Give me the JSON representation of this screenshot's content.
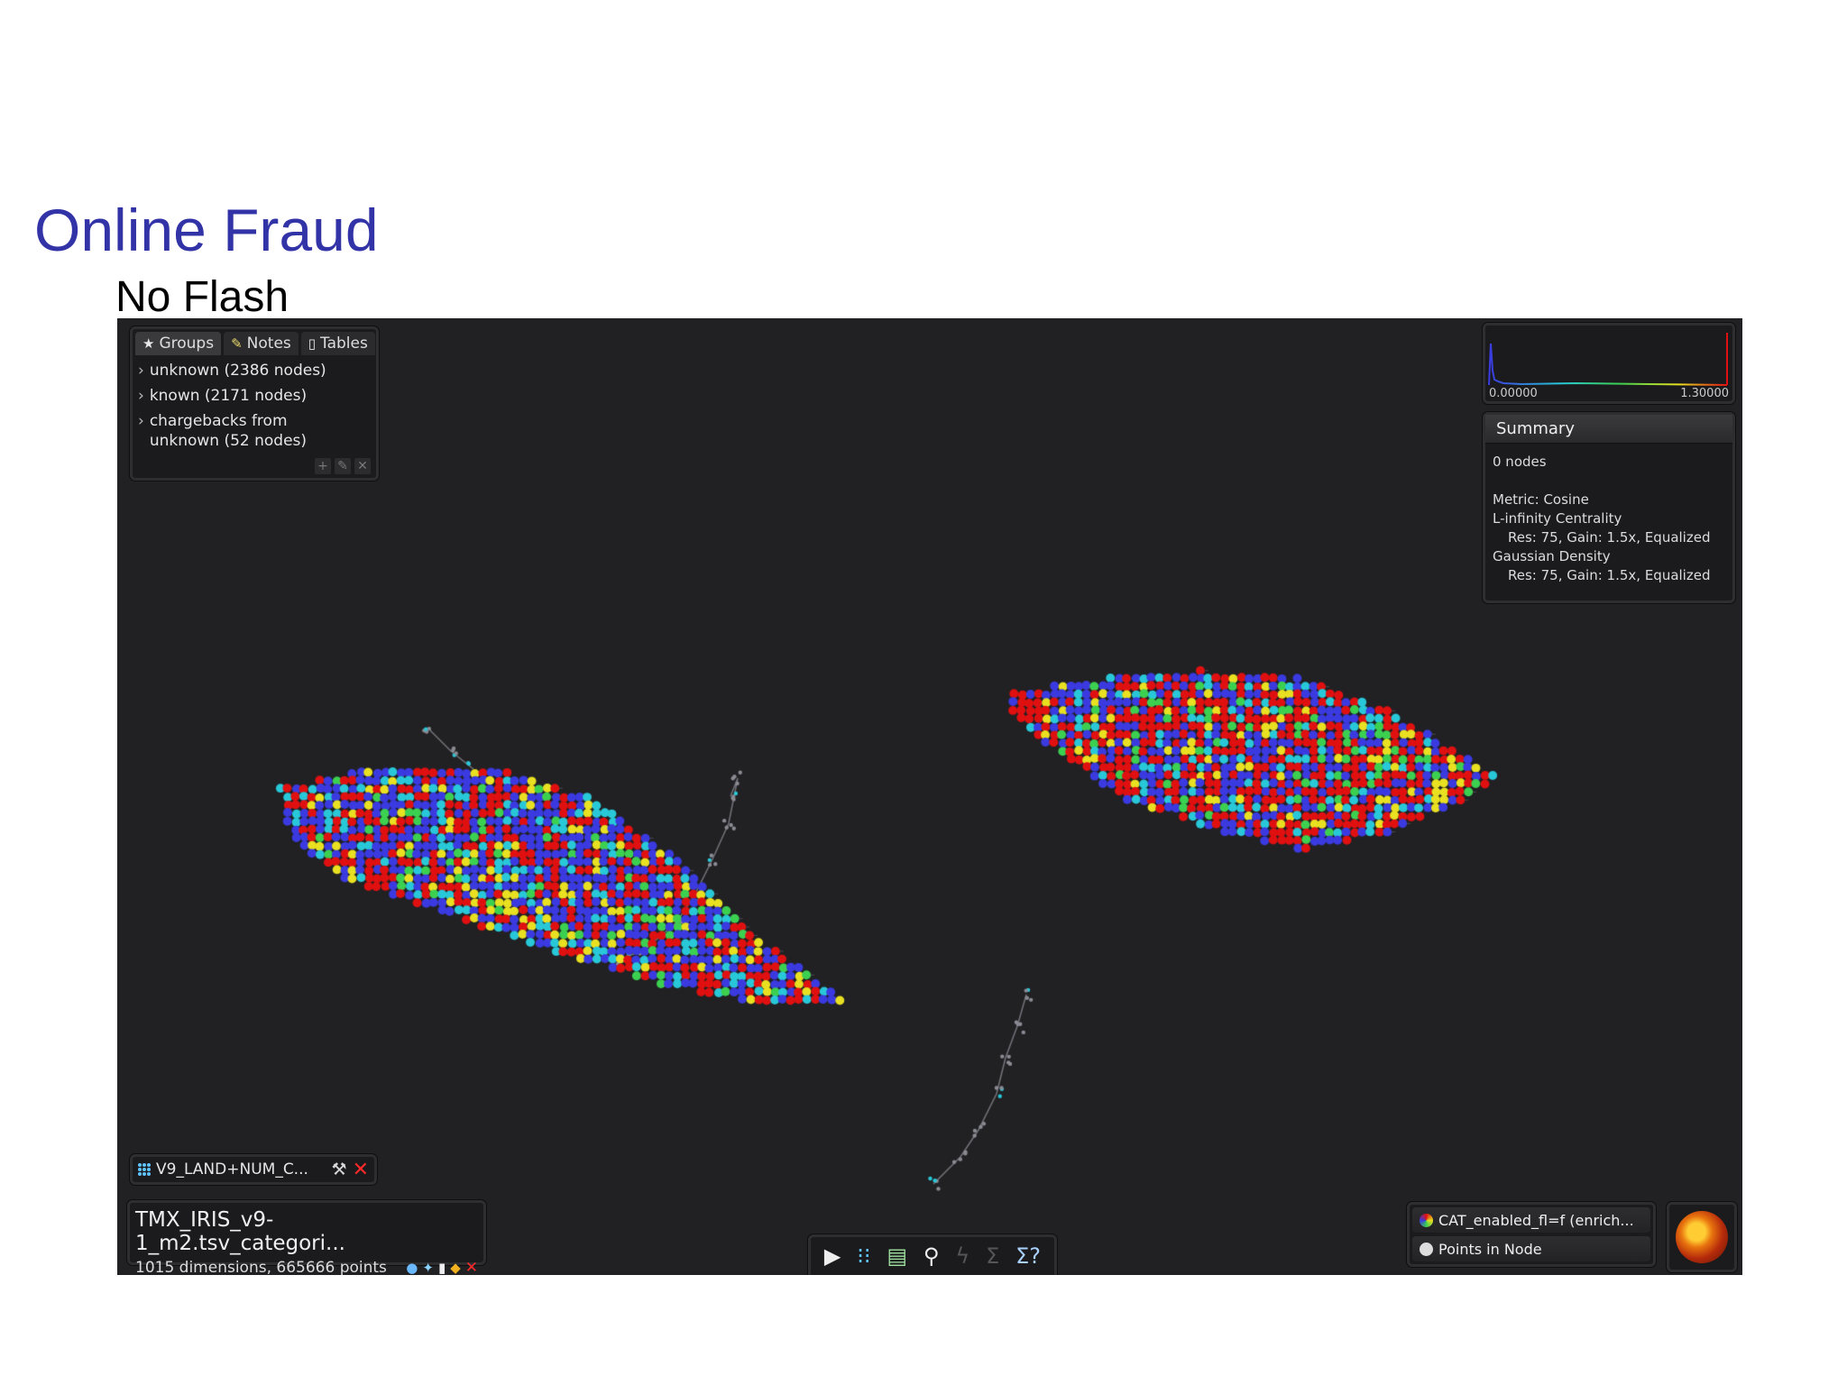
{
  "slide": {
    "title": "Online Fraud",
    "subtitle": "No Flash"
  },
  "groups_panel": {
    "tabs": [
      {
        "label": "Groups",
        "icon": "star-icon"
      },
      {
        "label": "Notes",
        "icon": "note-icon"
      },
      {
        "label": "Tables",
        "icon": "document-icon"
      }
    ],
    "items": [
      {
        "label": "unknown (2386 nodes)"
      },
      {
        "label": "known (2171 nodes)"
      },
      {
        "label": "chargebacks from unknown (52 nodes)"
      }
    ]
  },
  "histogram": {
    "min_label": "0.00000",
    "max_label": "1.30000"
  },
  "summary": {
    "title": "Summary",
    "nodes": "0 nodes",
    "metric": "Metric: Cosine",
    "lens1": "L-infinity Centrality",
    "lens1_params": "Res: 75, Gain: 1.5x, Equalized",
    "lens2": "Gaussian Density",
    "lens2_params": "Res: 75, Gain: 1.5x, Equalized"
  },
  "lens_panel": {
    "label": "V9_LAND+NUM_C..."
  },
  "dataset": {
    "name": "TMX_IRIS_v9-1_m2.tsv_categori...",
    "meta": "1015 dimensions, 665666 points"
  },
  "color_panel": {
    "color_by": "CAT_enabled_fl=f (enrich...",
    "size_by": "Points in Node"
  },
  "colors": {
    "background": "#212124",
    "red": "#e01010",
    "blue": "#3a3ae0",
    "cyan": "#28c8d8",
    "green": "#3cd050",
    "yellow": "#e8e020",
    "title": "#3333a8"
  }
}
